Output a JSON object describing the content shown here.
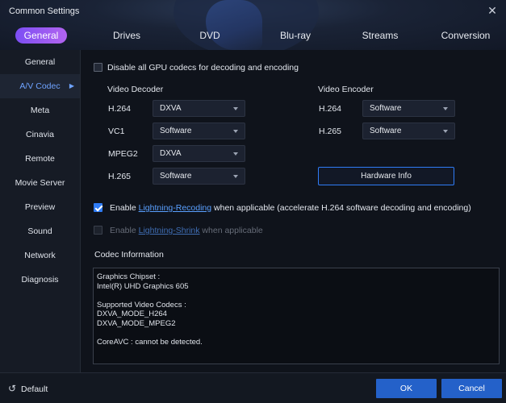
{
  "window": {
    "title": "Common Settings",
    "close_glyph": "✕"
  },
  "tabs": [
    {
      "label": "General",
      "active": true
    },
    {
      "label": "Drives"
    },
    {
      "label": "DVD"
    },
    {
      "label": "Blu-ray"
    },
    {
      "label": "Streams"
    },
    {
      "label": "Conversion"
    }
  ],
  "sidebar": {
    "items": [
      {
        "label": "General"
      },
      {
        "label": "A/V Codec",
        "active": true
      },
      {
        "label": "Meta"
      },
      {
        "label": "Cinavia"
      },
      {
        "label": "Remote"
      },
      {
        "label": "Movie Server"
      },
      {
        "label": "Preview"
      },
      {
        "label": "Sound"
      },
      {
        "label": "Network"
      },
      {
        "label": "Diagnosis"
      }
    ],
    "active_arrow": "▶"
  },
  "codec": {
    "disable_gpu": {
      "label": "Disable all GPU codecs for decoding and encoding",
      "checked": false
    },
    "decoder": {
      "heading": "Video Decoder",
      "rows": [
        {
          "label": "H.264",
          "value": "DXVA"
        },
        {
          "label": "VC1",
          "value": "Software"
        },
        {
          "label": "MPEG2",
          "value": "DXVA"
        },
        {
          "label": "H.265",
          "value": "Software"
        }
      ]
    },
    "encoder": {
      "heading": "Video Encoder",
      "rows": [
        {
          "label": "H.264",
          "value": "Software"
        },
        {
          "label": "H.265",
          "value": "Software"
        }
      ]
    },
    "hardware_info_button": "Hardware Info",
    "lightning_recoding": {
      "prefix": "Enable ",
      "link": "Lightning-Recoding",
      "suffix": " when applicable (accelerate H.264 software decoding and encoding)",
      "checked": true
    },
    "lightning_shrink": {
      "prefix": "Enable ",
      "link": "Lightning-Shrink",
      "suffix": " when applicable",
      "checked": false,
      "disabled": true
    },
    "info_heading": "Codec Information",
    "info_lines": [
      "Graphics Chipset :",
      "Intel(R) UHD Graphics 605",
      "",
      "Supported Video Codecs :",
      "DXVA_MODE_H264",
      "DXVA_MODE_MPEG2",
      "",
      "CoreAVC : cannot be detected."
    ]
  },
  "footer": {
    "default_label": "Default",
    "default_icon": "↺",
    "ok_label": "OK",
    "cancel_label": "Cancel"
  },
  "colors": {
    "accent": "#2f7cf6",
    "tab_active_start": "#7c4ef4",
    "tab_active_end": "#b264f0",
    "link": "#5aa0ff"
  }
}
